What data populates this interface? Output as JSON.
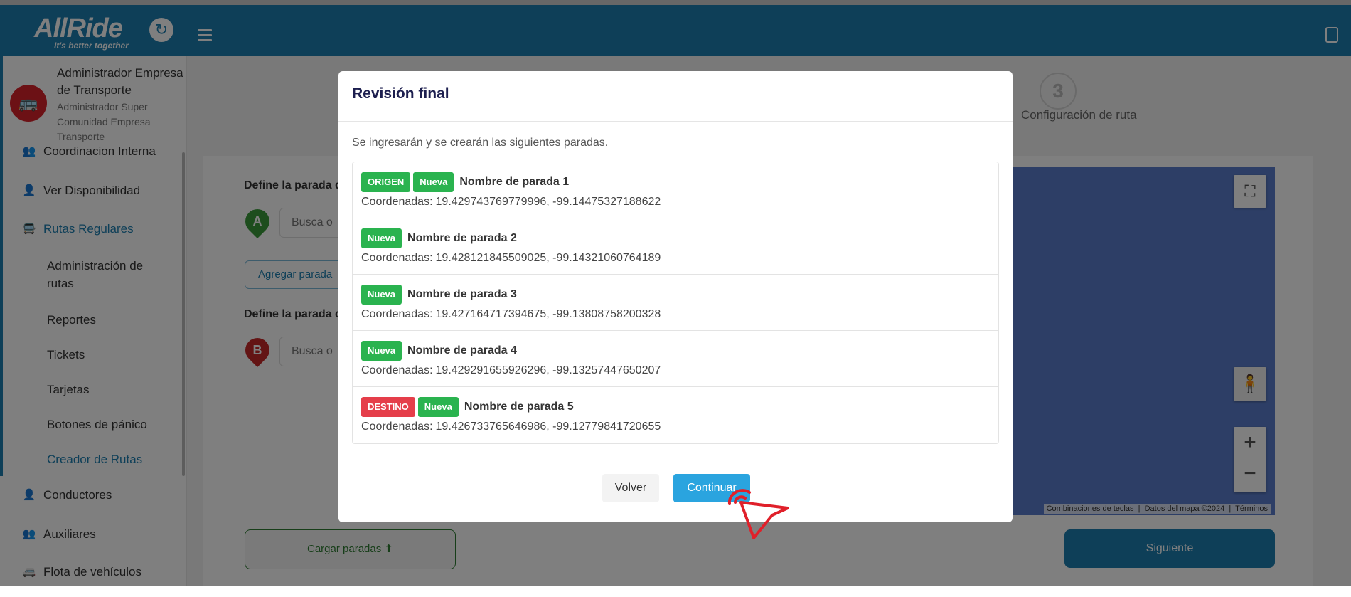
{
  "app": {
    "brand": "AllRide",
    "tagline": "It's better together"
  },
  "sidebar": {
    "user": {
      "name": "Administrador Empresa de Transporte",
      "role": "Administrador Super Comunidad Empresa Transporte"
    },
    "items": [
      {
        "label": "Coordinacion Interna",
        "icon": "users-coordination-icon"
      },
      {
        "label": "Ver Disponibilidad",
        "icon": "user-check-icon"
      },
      {
        "label": "Rutas Regulares",
        "icon": "bus-icon"
      },
      {
        "label": "Conductores",
        "icon": "person-icon"
      },
      {
        "label": "Auxiliares",
        "icon": "people-icon"
      },
      {
        "label": "Flota de vehículos",
        "icon": "car-icon"
      }
    ],
    "subitems": [
      "Administración de rutas",
      "Reportes",
      "Tickets",
      "Tarjetas",
      "Botones de pánico",
      "Creador de Rutas"
    ]
  },
  "background": {
    "step_number": "3",
    "step_label": "Configuración de ruta",
    "origin_label": "Define la parada d",
    "destination_label": "Define la parada d",
    "search_placeholder": "Busca o",
    "add_stop": "Agregar parada",
    "load_stops": "Cargar paradas",
    "next": "Siguiente",
    "pin_a": "A",
    "pin_b": "B",
    "map_footer": {
      "shortcuts": "Combinaciones de teclas",
      "map_data": "Datos del mapa ©2024",
      "terms": "Términos"
    }
  },
  "modal": {
    "title": "Revisión final",
    "intro": "Se ingresarán y se crearán las siguientes paradas.",
    "coords_label": "Coordenadas:",
    "stops": [
      {
        "badges": [
          "ORIGEN",
          "Nueva"
        ],
        "name": "Nombre de parada 1",
        "coords": "19.429743769779996, -99.14475327188622"
      },
      {
        "badges": [
          "Nueva"
        ],
        "name": "Nombre de parada 2",
        "coords": "19.428121845509025, -99.14321060764189"
      },
      {
        "badges": [
          "Nueva"
        ],
        "name": "Nombre de parada 3",
        "coords": "19.427164717394675, -99.13808758200328"
      },
      {
        "badges": [
          "Nueva"
        ],
        "name": "Nombre de parada 4",
        "coords": "19.429291655926296, -99.13257447650207"
      },
      {
        "badges": [
          "DESTINO",
          "Nueva"
        ],
        "name": "Nombre de parada 5",
        "coords": "19.426733765646986, -99.12779841720655"
      }
    ],
    "back_label": "Volver",
    "continue_label": "Continuar"
  },
  "colors": {
    "header": "#1d7fb0",
    "badge_green": "#2ab34f",
    "badge_red": "#e53e4a",
    "continue": "#2aa4df"
  }
}
